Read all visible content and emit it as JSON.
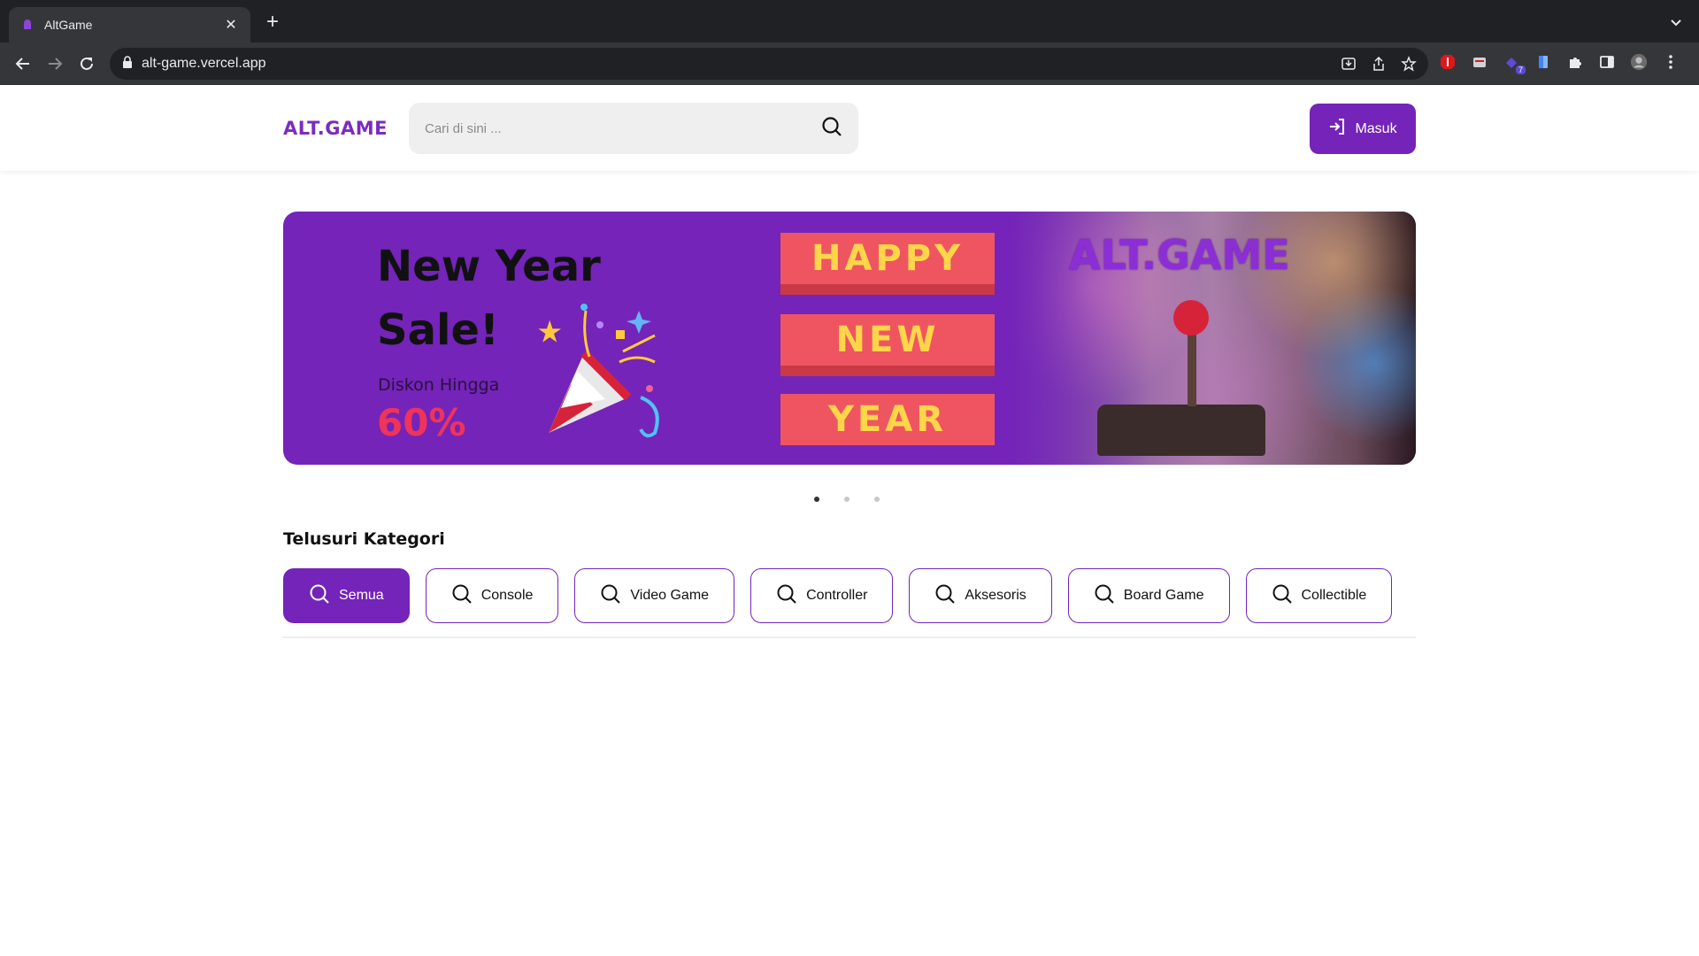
{
  "browser": {
    "tab_title": "AltGame",
    "url": "alt-game.vercel.app",
    "extension_badge": "7"
  },
  "header": {
    "logo": "ALT.GAME",
    "search_placeholder": "Cari di sini ...",
    "login_label": "Masuk"
  },
  "banner": {
    "title_line1": "New Year",
    "title_line2": "Sale!",
    "discount_label": "Diskon Hingga",
    "discount_value": "60%",
    "ribbon": [
      "HAPPY",
      "NEW",
      "YEAR"
    ],
    "brand": "ALT.GAME"
  },
  "carousel": {
    "slides": 3,
    "active": 1
  },
  "categories": {
    "title": "Telusuri Kategori",
    "items": [
      {
        "label": "Semua",
        "active": true
      },
      {
        "label": "Console",
        "active": false
      },
      {
        "label": "Video Game",
        "active": false
      },
      {
        "label": "Controller",
        "active": false
      },
      {
        "label": "Aksesoris",
        "active": false
      },
      {
        "label": "Board Game",
        "active": false
      },
      {
        "label": "Collectible",
        "active": false
      }
    ]
  },
  "colors": {
    "brand": "#7424b8",
    "accent_red": "#f0335a",
    "ribbon": "#ef5561",
    "ribbon_text": "#ffd54a"
  },
  "icons": {
    "search": "search-icon",
    "login": "login-icon",
    "category": "search-icon"
  }
}
